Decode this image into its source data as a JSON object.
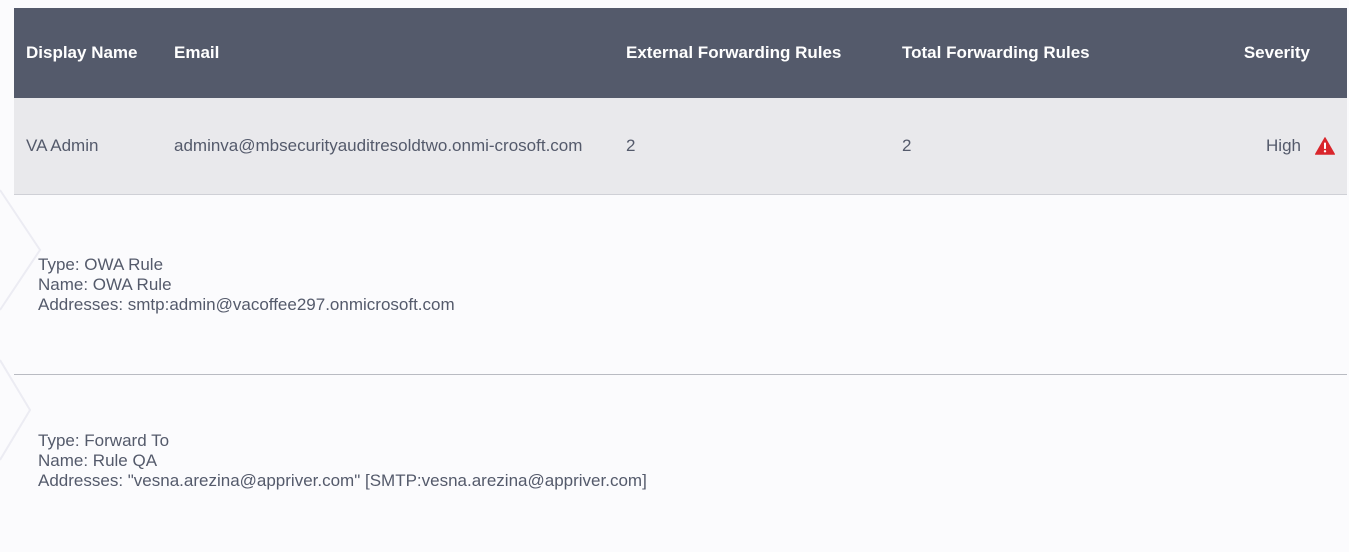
{
  "table": {
    "headers": {
      "display_name": "Display Name",
      "email": "Email",
      "external_rules": "External Forwarding Rules",
      "total_rules": "Total Forwarding Rules",
      "severity": "Severity"
    },
    "row": {
      "display_name": "VA Admin",
      "email": "adminva@mbsecurityauditresoldtwo.onmi-crosoft.com",
      "external_rules": "2",
      "total_rules": "2",
      "severity": "High",
      "severity_icon": "warning-icon",
      "severity_color": "#d9262c"
    }
  },
  "rules": [
    {
      "type": "Type: OWA Rule",
      "name": "Name: OWA Rule",
      "addresses": "Addresses: smtp:admin@vacoffee297.onmicrosoft.com"
    },
    {
      "type": "Type: Forward To",
      "name": "Name: Rule QA",
      "addresses": "Addresses: \"vesna.arezina@appriver.com\" [SMTP:vesna.arezina@appriver.com]"
    }
  ],
  "colors": {
    "header_bg": "#545a6b",
    "row_bg": "#e9e9ec"
  }
}
